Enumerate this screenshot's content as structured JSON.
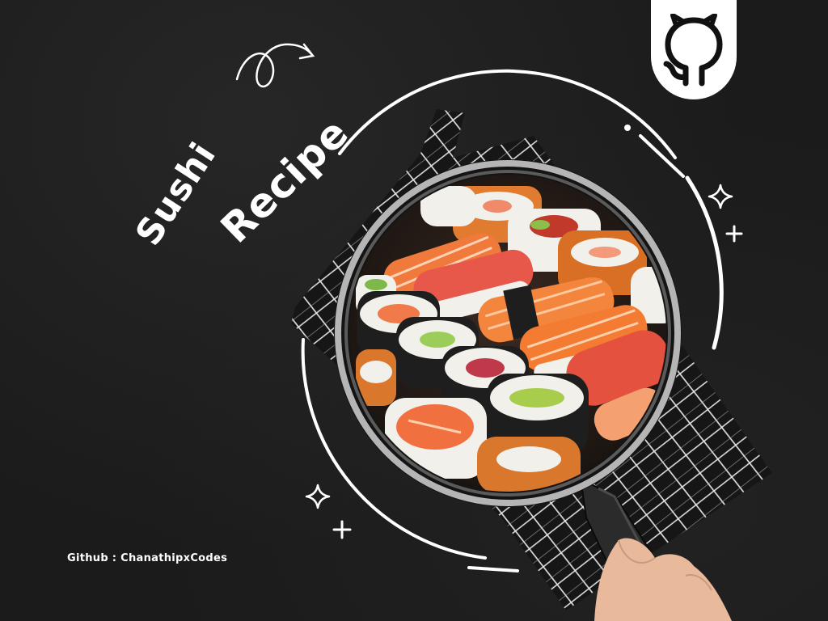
{
  "title": {
    "line1": "Sushi",
    "line2": "Recipe"
  },
  "credit": {
    "text": "Github : ChanathipxCodes"
  },
  "github_link": {
    "icon": "github-icon"
  },
  "colors": {
    "background": "#1b1b1b",
    "text": "#ffffff",
    "salmon": "#f26b3a",
    "rice": "#f2f0ea",
    "nori": "#1e1e1e"
  }
}
